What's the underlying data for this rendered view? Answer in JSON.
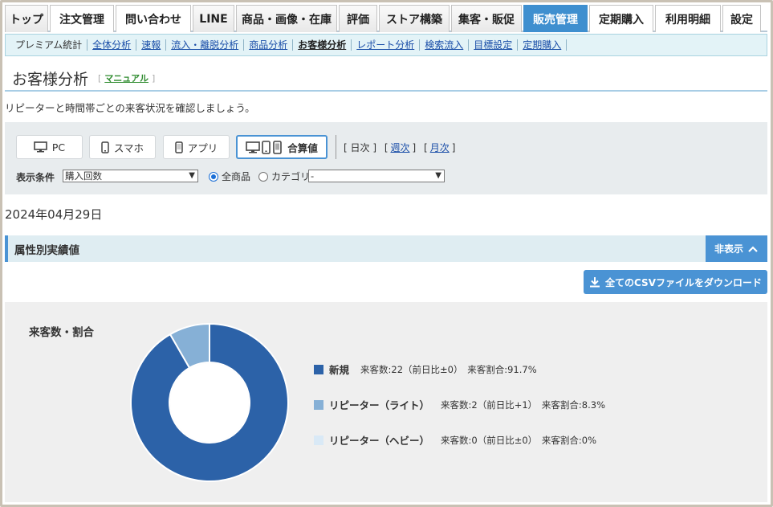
{
  "top_tabs": [
    {
      "label": "トップ",
      "w": 54,
      "style": "gray"
    },
    {
      "label": "注文管理",
      "w": 80,
      "style": "white"
    },
    {
      "label": "問い合わせ",
      "w": 94,
      "style": "white"
    },
    {
      "label": "LINE",
      "w": 52,
      "style": "gray"
    },
    {
      "label": "商品・画像・在庫",
      "w": 126,
      "style": "gray"
    },
    {
      "label": "評価",
      "w": 48,
      "style": "gray"
    },
    {
      "label": "ストア構築",
      "w": 88,
      "style": "gray"
    },
    {
      "label": "集客・販促",
      "w": 88,
      "style": "gray"
    },
    {
      "label": "販売管理",
      "w": 80,
      "style": "active"
    },
    {
      "label": "定期購入",
      "w": 80,
      "style": "white"
    },
    {
      "label": "利用明細",
      "w": 82,
      "style": "white"
    },
    {
      "label": "設定",
      "w": 48,
      "style": "white"
    }
  ],
  "sub_nav": [
    {
      "label": "プレミアム統計",
      "type": "plain"
    },
    {
      "label": "全体分析",
      "type": "link"
    },
    {
      "label": "速報",
      "type": "link"
    },
    {
      "label": "流入・離脱分析",
      "type": "link"
    },
    {
      "label": "商品分析",
      "type": "link"
    },
    {
      "label": "お客様分析",
      "type": "current"
    },
    {
      "label": "レポート分析",
      "type": "link"
    },
    {
      "label": "検索流入",
      "type": "link"
    },
    {
      "label": "目標設定",
      "type": "link"
    },
    {
      "label": "定期購入",
      "type": "link"
    }
  ],
  "page": {
    "title": "お客様分析",
    "manual_label": "マニュアル",
    "description": "リピーターと時間帯ごとの来客状況を確認しましょう。",
    "date": "2024年04月29日"
  },
  "filters": {
    "devices": [
      {
        "label": "PC",
        "icon": "monitor-icon"
      },
      {
        "label": "スマホ",
        "icon": "smartphone-icon"
      },
      {
        "label": "アプリ",
        "icon": "app-icon"
      },
      {
        "label": "合算値",
        "icon": "combined-devices-icon",
        "selected": true
      }
    ],
    "period_daily": "日次",
    "period_weekly": "週次",
    "period_monthly": "月次",
    "condition_label": "表示条件",
    "condition_value": "購入回数",
    "radio_all": "全商品",
    "radio_category": "カテゴリ",
    "category_value": "-"
  },
  "section": {
    "title": "属性別実績値",
    "hide_label": "非表示",
    "csv_label": "全てのCSVファイルをダウンロード"
  },
  "chart_data": {
    "type": "pie",
    "title": "来客数・割合",
    "donut": true,
    "categories": [
      "新規",
      "リピーター（ライト）",
      "リピーター（ヘビー）"
    ],
    "values": [
      22,
      2,
      0
    ],
    "colors": [
      "#2c62a8",
      "#86b0d6",
      "#d9e9f6"
    ],
    "legend": [
      {
        "name": "新規",
        "detail": "来客数:22（前日比±0）　来客割合:91.7%"
      },
      {
        "name": "リピーター（ライト）",
        "detail": "来客数:2（前日比+1）　来客割合:8.3%"
      },
      {
        "name": "リピーター（ヘビー）",
        "detail": "来客数:0（前日比±0）　来客割合:0%"
      }
    ]
  }
}
